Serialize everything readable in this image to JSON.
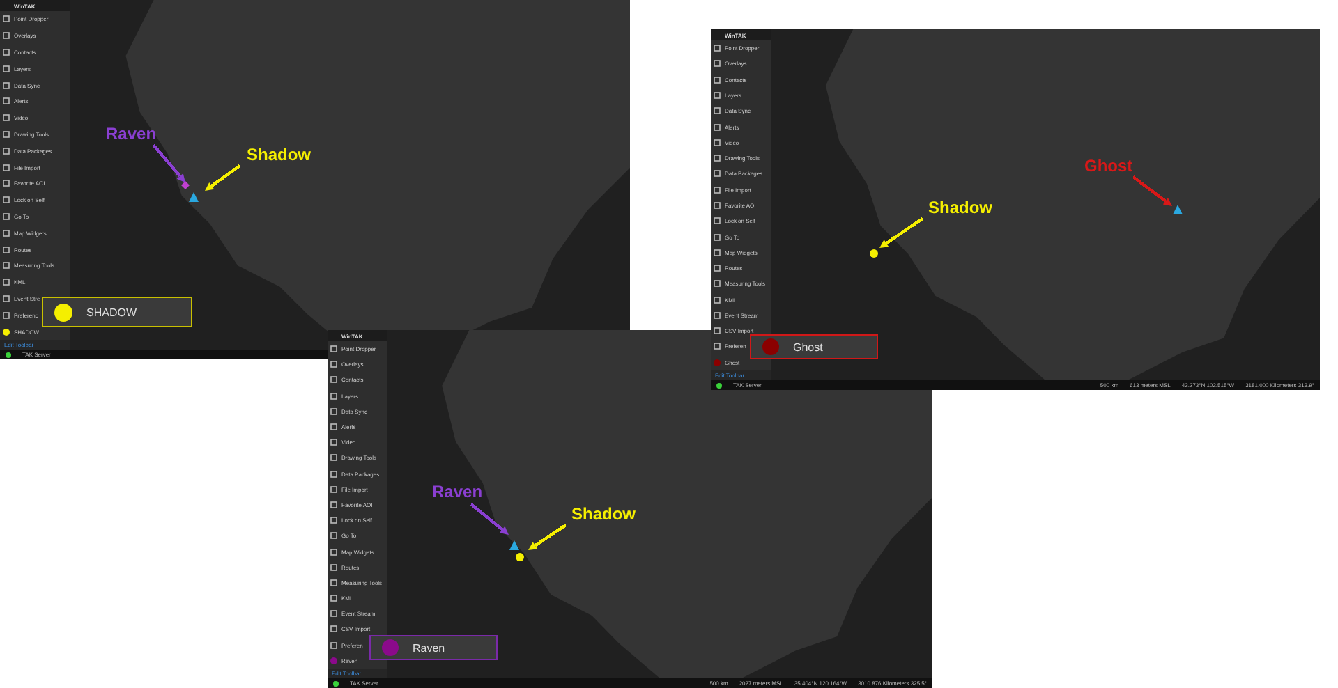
{
  "screenshots": [
    {
      "app_title": "WinTAK",
      "menu": [
        "Point Dropper",
        "Overlays",
        "Contacts",
        "Layers",
        "Data Sync",
        "Alerts",
        "Video",
        "Drawing Tools",
        "Data Packages",
        "File Import",
        "Favorite AOI",
        "Lock on Self",
        "Go To",
        "Map Widgets",
        "Routes",
        "Measuring Tools",
        "KML",
        "Event Stre",
        "Preferenc"
      ],
      "self": {
        "label": "SHADOW",
        "color": "#f5ef00"
      },
      "edit_toolbar": "Edit Toolbar",
      "server": "TAK Server",
      "callout": {
        "label": "SHADOW",
        "color": "#f5ef00"
      },
      "annotations": [
        {
          "label": "Raven",
          "color": "#8a3fd1"
        },
        {
          "label": "Shadow",
          "color": "#f5ef00"
        }
      ],
      "markers": [
        {
          "kind": "diamond",
          "color": "#c040d0"
        },
        {
          "kind": "triangle",
          "color": "#2aa8e0"
        }
      ]
    },
    {
      "app_title": "WinTAK",
      "menu": [
        "Point Dropper",
        "Overlays",
        "Contacts",
        "Layers",
        "Data Sync",
        "Alerts",
        "Video",
        "Drawing Tools",
        "Data Packages",
        "File Import",
        "Favorite AOI",
        "Lock on Self",
        "Go To",
        "Map Widgets",
        "Routes",
        "Measuring Tools",
        "KML",
        "Event Stream",
        "CSV Import",
        "Preferen"
      ],
      "self": {
        "label": "Ghost",
        "color": "#8b0000"
      },
      "edit_toolbar": "Edit Toolbar",
      "server": "TAK Server",
      "callout": {
        "label": "Ghost",
        "color": "#8b0000"
      },
      "annotations": [
        {
          "label": "Ghost",
          "color": "#d81818"
        },
        {
          "label": "Shadow",
          "color": "#f5ef00"
        }
      ],
      "markers": [
        {
          "kind": "triangle",
          "color": "#2aa8e0"
        },
        {
          "kind": "circle",
          "color": "#f5ef00"
        }
      ],
      "status": [
        "500 km",
        "613 meters MSL",
        "43.273°N 102.515°W",
        "3181.000 Kilometers 313.9°"
      ]
    },
    {
      "app_title": "WinTAK",
      "menu": [
        "Point Dropper",
        "Overlays",
        "Contacts",
        "Layers",
        "Data Sync",
        "Alerts",
        "Video",
        "Drawing Tools",
        "Data Packages",
        "File Import",
        "Favorite AOI",
        "Lock on Self",
        "Go To",
        "Map Widgets",
        "Routes",
        "Measuring Tools",
        "KML",
        "Event Stream",
        "CSV Import",
        "Preferen"
      ],
      "self": {
        "label": "Raven",
        "color": "#8b0a8b"
      },
      "edit_toolbar": "Edit Toolbar",
      "server": "TAK Server",
      "callout": {
        "label": "Raven",
        "color": "#8b0a8b"
      },
      "annotations": [
        {
          "label": "Raven",
          "color": "#8a3fd1"
        },
        {
          "label": "Shadow",
          "color": "#f5ef00"
        }
      ],
      "markers": [
        {
          "kind": "triangle",
          "color": "#2aa8e0"
        },
        {
          "kind": "circle",
          "color": "#f5ef00"
        }
      ],
      "status": [
        "500 km",
        "2027 meters MSL",
        "35.404°N 120.164°W",
        "3010.876 Kilometers 325.5°"
      ]
    }
  ]
}
